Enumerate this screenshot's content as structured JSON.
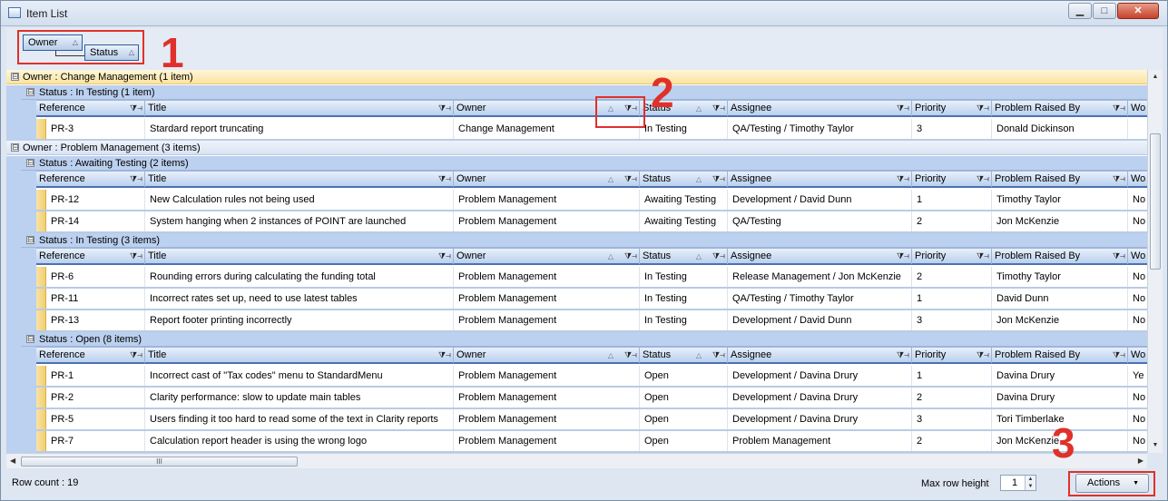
{
  "window": {
    "title": "Item List",
    "min_label": "▁",
    "max_label": "□",
    "close_label": "✕"
  },
  "groupby": {
    "chips": [
      {
        "label": "Owner",
        "arrow": "△"
      },
      {
        "label": "Status",
        "arrow": "△"
      }
    ]
  },
  "annotations": {
    "one": "1",
    "two": "2",
    "three": "3"
  },
  "icons": {
    "filter_pin": "⧩⊣",
    "sort": "△",
    "expand": "⊟"
  },
  "columns": [
    "Reference",
    "Title",
    "Owner",
    "Status",
    "Assignee",
    "Priority",
    "Problem Raised By",
    "Wo"
  ],
  "groups": [
    {
      "label": "Owner : Change Management (1 item)",
      "highlight": true,
      "subgroups": [
        {
          "label": "Status : In Testing (1 item)",
          "rows": [
            [
              "PR-3",
              "Stardard report truncating",
              "Change Management",
              "In Testing",
              "QA/Testing / Timothy Taylor",
              "3",
              "Donald Dickinson",
              ""
            ]
          ]
        }
      ]
    },
    {
      "label": "Owner : Problem Management (3 items)",
      "highlight": false,
      "subgroups": [
        {
          "label": "Status : Awaiting Testing (2 items)",
          "rows": [
            [
              "PR-12",
              "New Calculation rules not being used",
              "Problem Management",
              "Awaiting Testing",
              "Development / David Dunn",
              "1",
              "Timothy Taylor",
              "No"
            ],
            [
              "PR-14",
              "System hanging when 2 instances of POINT are launched",
              "Problem Management",
              "Awaiting Testing",
              "QA/Testing",
              "2",
              "Jon McKenzie",
              "No"
            ]
          ]
        },
        {
          "label": "Status : In Testing (3 items)",
          "rows": [
            [
              "PR-6",
              "Rounding errors during calculating the funding total",
              "Problem Management",
              "In Testing",
              "Release Management / Jon McKenzie",
              "2",
              "Timothy Taylor",
              "No"
            ],
            [
              "PR-11",
              "Incorrect rates set up, need to use latest tables",
              "Problem Management",
              "In Testing",
              "QA/Testing / Timothy Taylor",
              "1",
              "David Dunn",
              "No"
            ],
            [
              "PR-13",
              "Report footer printing incorrectly",
              "Problem Management",
              "In Testing",
              "Development / David Dunn",
              "3",
              "Jon McKenzie",
              "No"
            ]
          ]
        },
        {
          "label": "Status : Open (8 items)",
          "rows": [
            [
              "PR-1",
              "Incorrect cast of \"Tax codes\" menu to StandardMenu",
              "Problem Management",
              "Open",
              "Development / Davina Drury",
              "1",
              "Davina Drury",
              "Ye"
            ],
            [
              "PR-2",
              "Clarity performance: slow to update main tables",
              "Problem Management",
              "Open",
              "Development / Davina Drury",
              "2",
              "Davina Drury",
              "No"
            ],
            [
              "PR-5",
              "Users finding it too hard to read some of the text in Clarity reports",
              "Problem Management",
              "Open",
              "Development / Davina Drury",
              "3",
              "Tori Timberlake",
              "No"
            ],
            [
              "PR-7",
              "Calculation report header is using the wrong logo",
              "Problem Management",
              "Open",
              "Problem Management",
              "2",
              "Jon McKenzie",
              "No"
            ]
          ]
        }
      ]
    }
  ],
  "scroll": {
    "hthumb": "III"
  },
  "status": {
    "row_count": "Row count : 19",
    "max_row_height_label": "Max row height",
    "max_row_height_value": "1",
    "actions_label": "Actions",
    "actions_arrow": "▼"
  }
}
